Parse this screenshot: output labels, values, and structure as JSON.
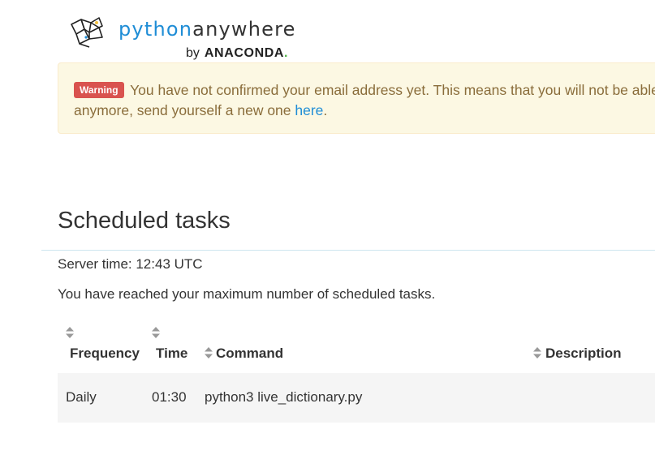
{
  "brand": {
    "python": "python",
    "anywhere": "anywhere",
    "by": "by",
    "company": "ANACONDA",
    "company_dot": "."
  },
  "alert": {
    "badge": "Warning",
    "message": "You have not confirmed your email address yet. This means that you will not be able",
    "message_line2": "anymore, send yourself a new one ",
    "link": "here",
    "end": "."
  },
  "page": {
    "title": "Scheduled tasks",
    "server_time": "Server time: 12:43 UTC",
    "limit_note": "You have reached your maximum number of scheduled tasks."
  },
  "table": {
    "headers": {
      "frequency": "Frequency",
      "time": "Time",
      "command": "Command",
      "description": "Description"
    },
    "rows": [
      {
        "frequency": "Daily",
        "time": "01:30",
        "command": "python3 live_dictionary.py",
        "description": ""
      }
    ]
  },
  "colors": {
    "accent": "#1f8dd6",
    "warning_badge": "#d9534f",
    "alert_bg": "#fcf8e3",
    "alert_text": "#8a6d3b"
  }
}
